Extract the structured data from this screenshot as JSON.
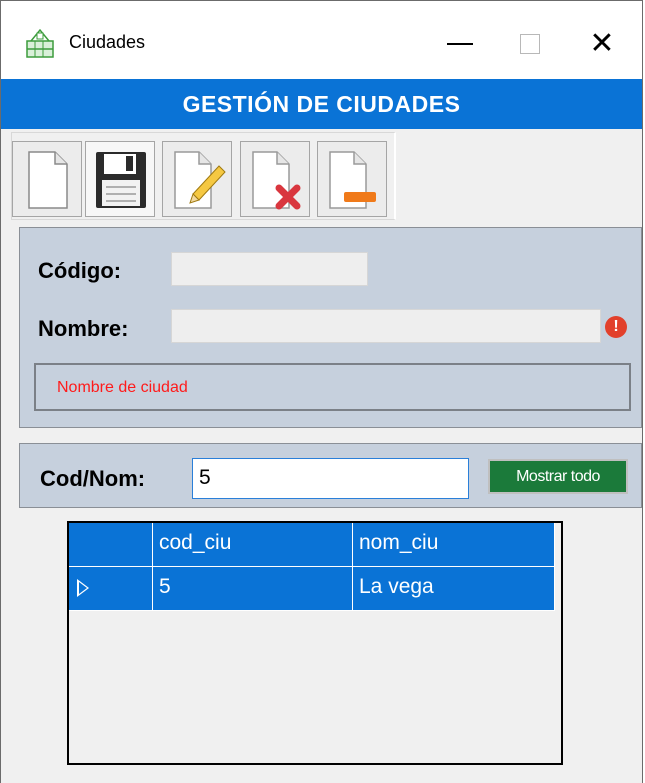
{
  "window": {
    "title": "Ciudades",
    "icon": "app-window-icon",
    "controls": {
      "minimize": "minimize-icon",
      "maximize": "maximize-icon",
      "close": "close-icon"
    }
  },
  "header": {
    "title": "GESTIÓN DE CIUDADES"
  },
  "toolbar": {
    "buttons": [
      {
        "name": "new-document-icon"
      },
      {
        "name": "save-icon"
      },
      {
        "name": "edit-icon"
      },
      {
        "name": "delete-icon"
      },
      {
        "name": "remove-icon"
      }
    ]
  },
  "form": {
    "codigo_label": "Código:",
    "codigo_value": "",
    "nombre_label": "Nombre:",
    "nombre_value": "",
    "error_icon": "error-icon",
    "message": "Nombre de ciudad"
  },
  "search": {
    "label": "Cod/Nom:",
    "value": "5",
    "show_all_label": "Mostrar todo"
  },
  "grid": {
    "columns": [
      "cod_ciu",
      "nom_ciu"
    ],
    "rows": [
      {
        "cod_ciu": "5",
        "nom_ciu": "La vega"
      }
    ]
  },
  "colors": {
    "accent": "#0a73d6",
    "panel": "#c6d0dd",
    "error": "#ff1a1a",
    "button_green": "#1b7a3a"
  }
}
